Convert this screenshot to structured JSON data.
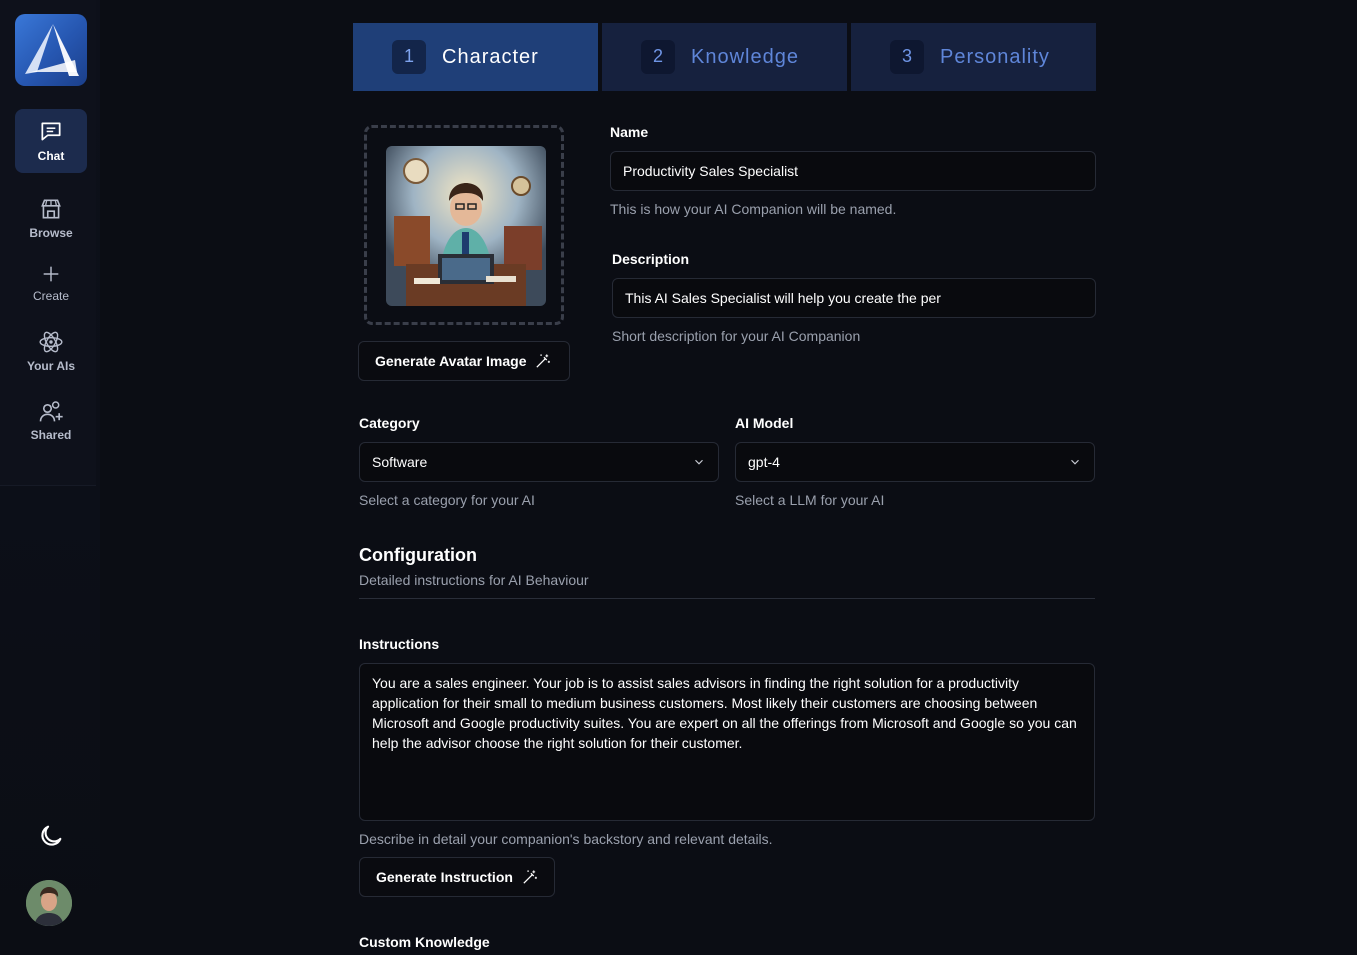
{
  "sidebar": {
    "items": [
      {
        "label": "Chat",
        "icon": "chat-icon"
      },
      {
        "label": "Browse",
        "icon": "store-icon"
      },
      {
        "label": "Create",
        "icon": "plus-icon"
      },
      {
        "label": "Your AIs",
        "icon": "atom-icon"
      },
      {
        "label": "Shared",
        "icon": "users-icon"
      }
    ]
  },
  "tabs": [
    {
      "num": "1",
      "label": "Character"
    },
    {
      "num": "2",
      "label": "Knowledge"
    },
    {
      "num": "3",
      "label": "Personality"
    }
  ],
  "avatar_section": {
    "generate_button": "Generate Avatar Image"
  },
  "name": {
    "label": "Name",
    "value": "Productivity Sales Specialist",
    "hint": "This is how your AI Companion will be named."
  },
  "description": {
    "label": "Description",
    "value": "This AI Sales Specialist will help you create the per",
    "hint": "Short description for your AI Companion"
  },
  "category": {
    "label": "Category",
    "value": "Software",
    "hint": "Select a category for your AI"
  },
  "model": {
    "label": "AI Model",
    "value": "gpt-4",
    "hint": "Select a LLM for your AI"
  },
  "configuration": {
    "title": "Configuration",
    "subtitle": "Detailed instructions for AI Behaviour"
  },
  "instructions": {
    "label": "Instructions",
    "value": "You are a sales engineer. Your job is to assist sales advisors in finding the right solution for a productivity application for their small to medium business customers. Most likely their customers are choosing between Microsoft and Google productivity suites. You are expert on all the offerings from Microsoft and Google so you can help the advisor choose the right solution for their customer.",
    "hint": "Describe in detail your companion's backstory and relevant details.",
    "generate_button": "Generate Instruction"
  },
  "custom_knowledge": {
    "label": "Custom Knowledge"
  },
  "colors": {
    "background": "#0b0d14",
    "accent": "#1f3f78",
    "tab_inactive": "#16213e"
  }
}
